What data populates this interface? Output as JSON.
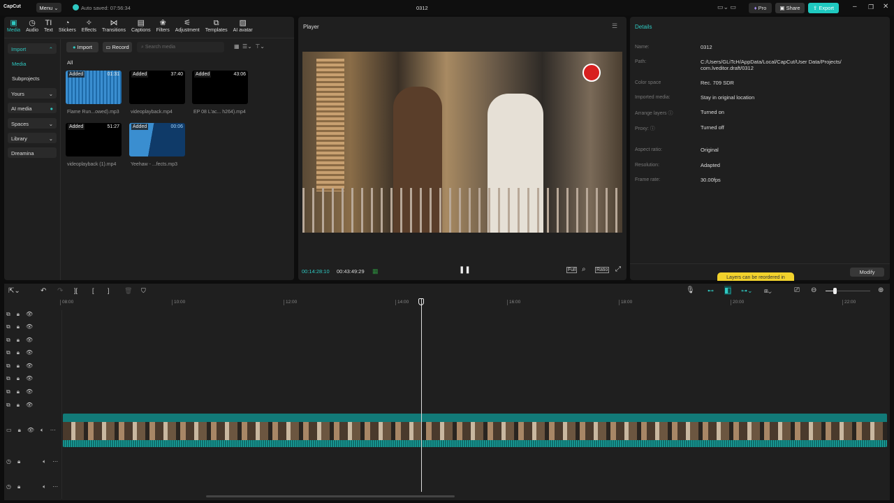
{
  "titlebar": {
    "logo": "CapCut",
    "menu": "Menu",
    "autosave": "Auto saved: 07:56:34",
    "project": "0312",
    "pro": "Pro",
    "share": "Share",
    "export": "Export"
  },
  "tabs": [
    {
      "label": "Media",
      "icon": "media-icon"
    },
    {
      "label": "Audio",
      "icon": "audio-icon"
    },
    {
      "label": "Text",
      "icon": "text-icon"
    },
    {
      "label": "Stickers",
      "icon": "stickers-icon"
    },
    {
      "label": "Effects",
      "icon": "effects-icon"
    },
    {
      "label": "Transitions",
      "icon": "transitions-icon"
    },
    {
      "label": "Captions",
      "icon": "captions-icon"
    },
    {
      "label": "Filters",
      "icon": "filters-icon"
    },
    {
      "label": "Adjustment",
      "icon": "adjustment-icon"
    },
    {
      "label": "Templates",
      "icon": "templates-icon"
    },
    {
      "label": "AI avatar",
      "icon": "ai-avatar-icon"
    }
  ],
  "sidebar": {
    "import": "Import",
    "media": "Media",
    "subprojects": "Subprojects",
    "yours": "Yours",
    "ai_media": "AI media",
    "spaces": "Spaces",
    "library": "Library",
    "dreamina": "Dreamina"
  },
  "media": {
    "import_btn": "Import",
    "record_btn": "Record",
    "search_placeholder": "Search media",
    "filter": "All",
    "items": [
      {
        "name": "Flame Run...owed).mp3",
        "duration": "01:31",
        "badge": "Added",
        "kind": "audio"
      },
      {
        "name": "videoplayback.mp4",
        "duration": "37:40",
        "badge": "Added",
        "kind": "video"
      },
      {
        "name": "EP 08 L'ac... h264).mp4",
        "duration": "43:06",
        "badge": "Added",
        "kind": "video"
      },
      {
        "name": "videoplayback (1).mp4",
        "duration": "51:27",
        "badge": "Added",
        "kind": "video"
      },
      {
        "name": "Yeehaw - ...fects.mp3",
        "duration": "00:06",
        "badge": "Added",
        "kind": "audio"
      }
    ]
  },
  "player": {
    "title": "Player",
    "current": "00:14:28:10",
    "total": "00:43:49:29",
    "full": "Full",
    "ratio": "Ratio"
  },
  "details": {
    "title": "Details",
    "rows": [
      {
        "label": "Name:",
        "value": "0312"
      },
      {
        "label": "Path:",
        "value": "C:/Users/GLiTcH/AppData/Local/CapCut/User Data/Projects/ com.lveditor.draft/0312"
      },
      {
        "label": "Color space",
        "value": "Rec. 709 SDR"
      },
      {
        "label": "Imported media:",
        "value": "Stay in original location"
      },
      {
        "label": "Arrange layers ⓘ",
        "value": "Turned on"
      },
      {
        "label": "Proxy: ⓘ",
        "value": "Turned off"
      },
      {
        "label": "Aspect ratio:",
        "value": "Original"
      },
      {
        "label": "Resolution:",
        "value": "Adapted"
      },
      {
        "label": "Frame rate:",
        "value": "30.00fps"
      }
    ],
    "tooltip": "Layers can be reordered in",
    "modify": "Modify"
  },
  "timeline": {
    "ruler": [
      "08:00",
      "10:00",
      "12:00",
      "14:00",
      "16:00",
      "18:00",
      "20:00",
      "22:00"
    ],
    "zoom_level": 0.2
  },
  "colors": {
    "accent": "#2fc9c2",
    "export": "#1fc9c0",
    "tooltip": "#f2d22c"
  }
}
